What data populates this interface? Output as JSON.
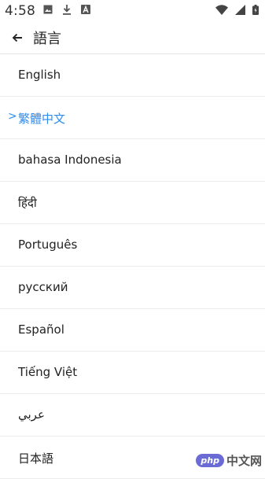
{
  "status_bar": {
    "time": "4:58",
    "left_icons": [
      "image-icon",
      "download-icon",
      "a-badge-icon"
    ],
    "right_icons": [
      "wifi-icon",
      "signal-icon",
      "battery-icon"
    ]
  },
  "app_bar": {
    "back_icon": "arrow-back-icon",
    "title": "語言"
  },
  "languages": [
    {
      "label": "English",
      "selected": false
    },
    {
      "label": "繁體中文",
      "selected": true,
      "marker": ">"
    },
    {
      "label": "bahasa Indonesia",
      "selected": false
    },
    {
      "label": "हिंदी",
      "selected": false
    },
    {
      "label": "Português",
      "selected": false
    },
    {
      "label": "русский",
      "selected": false
    },
    {
      "label": "Español",
      "selected": false
    },
    {
      "label": "Tiếng Việt",
      "selected": false
    },
    {
      "label": "عربي",
      "selected": false
    },
    {
      "label": "日本語",
      "selected": false
    }
  ],
  "watermark": {
    "badge": "php",
    "text": "中文网"
  },
  "colors": {
    "accent": "#2d8cf0",
    "text": "#222222",
    "divider": "#ececec"
  }
}
